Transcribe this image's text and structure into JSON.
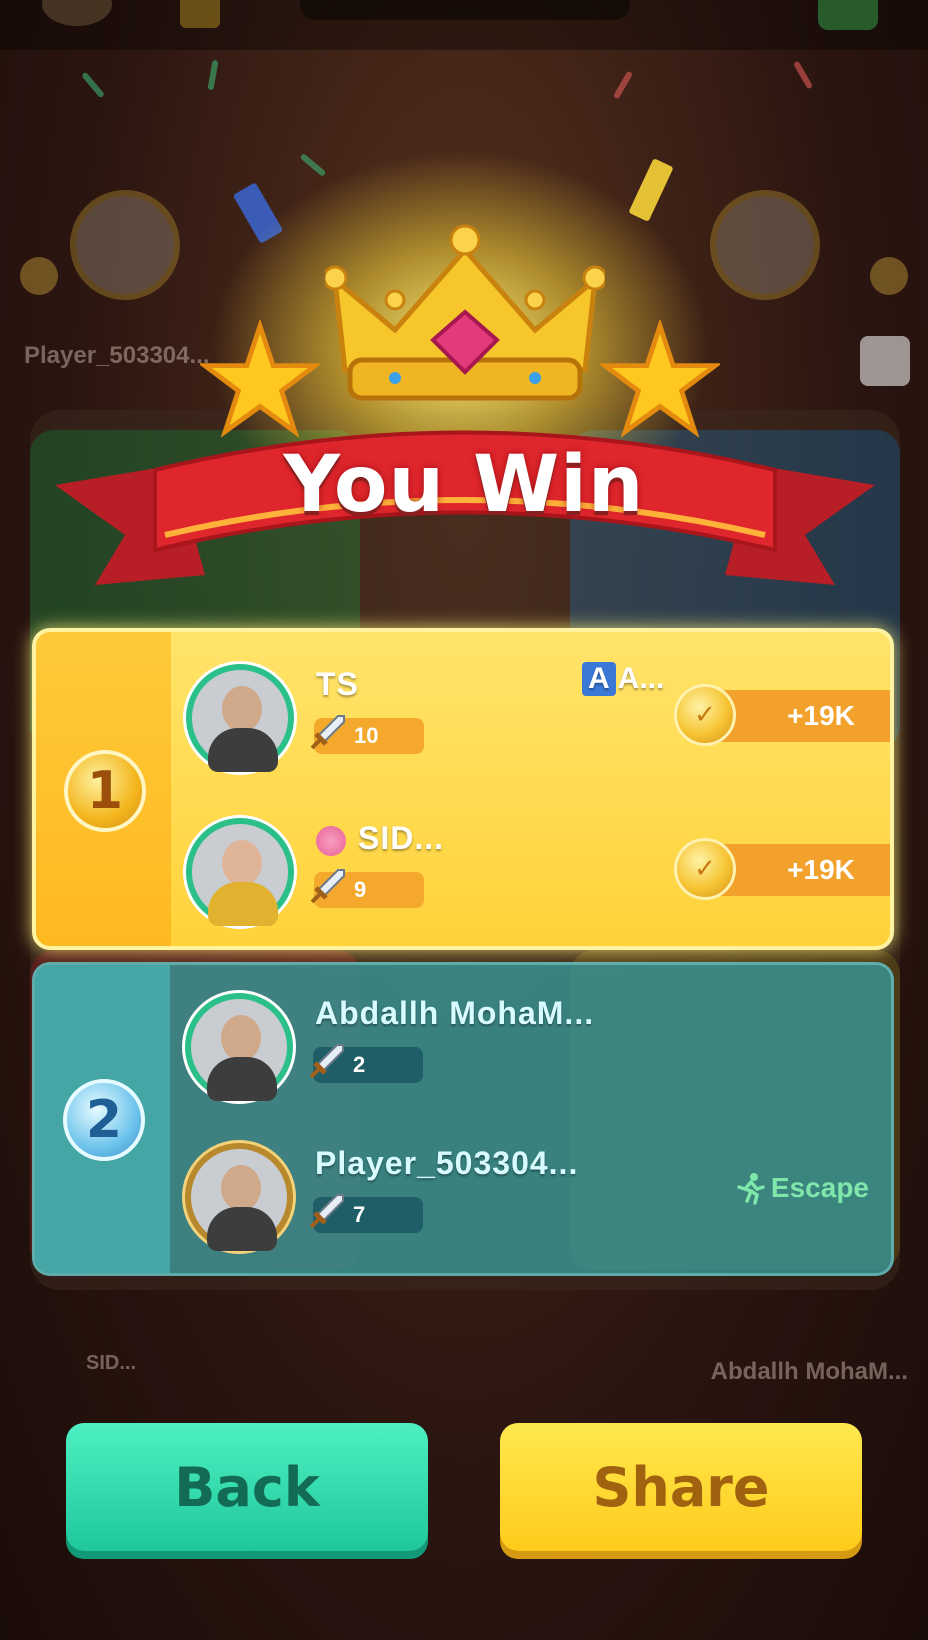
{
  "title": "You Win",
  "background": {
    "top_left_name": "Player_503304...",
    "bottom_left_name": "SID...",
    "bottom_right_name": "Abdallh MohaM..."
  },
  "ranks": [
    {
      "rank": "1",
      "players": [
        {
          "name": "TS",
          "tag": "A...",
          "tag_box": "A",
          "score": "10",
          "reward": "+19K"
        },
        {
          "name": "SID...",
          "score": "9",
          "reward": "+19K"
        }
      ]
    },
    {
      "rank": "2",
      "players": [
        {
          "name": "Abdallh MohaM...",
          "score": "2"
        },
        {
          "name": "Player_503304...",
          "score": "7",
          "status": "Escape"
        }
      ]
    }
  ],
  "buttons": {
    "back": "Back",
    "share": "Share"
  },
  "colors": {
    "gold_panel": "#ffd23a",
    "teal_panel": "#389696",
    "back_button": "#1fc79b",
    "share_button": "#ffcb1b",
    "ribbon": "#d8262c"
  },
  "icons": {
    "coin": "coin-icon",
    "sword": "sword-icon",
    "escape": "running-man-icon",
    "crown": "crown-icon",
    "star": "star-icon"
  }
}
